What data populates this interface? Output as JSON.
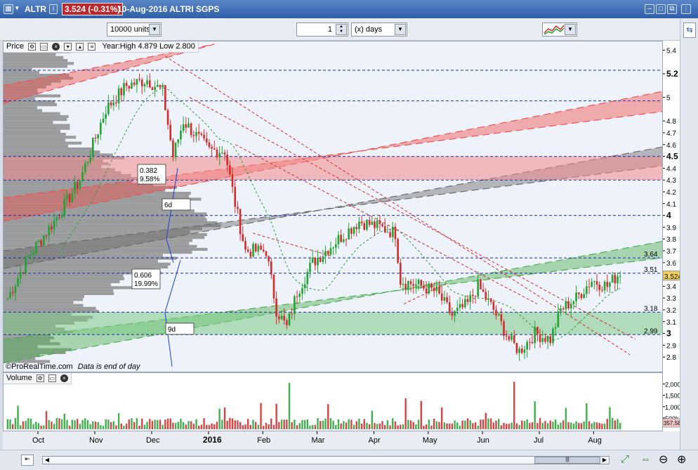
{
  "window": {
    "ticker": "ALTR",
    "price_change": "3.524 (-0.31%)",
    "date_name": "10-Aug-2016 ALTRI SGPS"
  },
  "toolbar": {
    "units_value": "10000 units",
    "period_value": "1",
    "period_unit": "(x) days"
  },
  "price_panel": {
    "label": "Price",
    "yearinfo": "Year:High 4.879 Low 2.800",
    "credit": "©ProRealTime.com",
    "note": "Data is end of day",
    "fib1_ratio": "0.382",
    "fib1_pct": "9.58%",
    "fib2_ratio": "0.606",
    "fib2_pct": "19.99%",
    "cycle1": "6d",
    "cycle2": "9d"
  },
  "volume_panel": {
    "label": "Volume",
    "axis_labels": [
      "2,000k",
      "1,500k",
      "1,000k",
      "500k"
    ],
    "last_value": "357,587"
  },
  "colors": {
    "up": "#22a233",
    "down": "#d62a2a",
    "accent": "#2f5ea8",
    "volume_up": "#3fb24f",
    "volume_down": "#d64545"
  },
  "chart_data": {
    "type": "candlestick",
    "ylim": [
      2.7,
      5.45
    ],
    "y_ticks": [
      {
        "v": 5.4,
        "label": "5.4"
      },
      {
        "v": 5.2,
        "label": "5.2",
        "bold": true
      },
      {
        "v": 5.0,
        "label": "5"
      },
      {
        "v": 4.8,
        "label": "4.8"
      },
      {
        "v": 4.7,
        "label": "4.7"
      },
      {
        "v": 4.6,
        "label": "4.6"
      },
      {
        "v": 4.5,
        "label": "4.5",
        "bold": true
      },
      {
        "v": 4.4,
        "label": "4.4"
      },
      {
        "v": 4.3,
        "label": "4.3"
      },
      {
        "v": 4.2,
        "label": "4.2"
      },
      {
        "v": 4.1,
        "label": "4.1"
      },
      {
        "v": 4.0,
        "label": "4",
        "bold": true
      },
      {
        "v": 3.9,
        "label": "3.9"
      },
      {
        "v": 3.8,
        "label": "3.8"
      },
      {
        "v": 3.7,
        "label": "3.7"
      },
      {
        "v": 3.6,
        "label": "3.6"
      },
      {
        "v": 3.5,
        "label": "3.5"
      },
      {
        "v": 3.4,
        "label": "3.4"
      },
      {
        "v": 3.3,
        "label": "3.3"
      },
      {
        "v": 3.2,
        "label": "3.2"
      },
      {
        "v": 3.1,
        "label": "3.1"
      },
      {
        "v": 3.0,
        "label": "3",
        "bold": true
      },
      {
        "v": 2.9,
        "label": "2.9"
      },
      {
        "v": 2.8,
        "label": "2.8"
      }
    ],
    "level_labels": [
      {
        "v": 3.64,
        "label": "3.64"
      },
      {
        "v": 3.51,
        "label": "3.51"
      },
      {
        "v": 3.18,
        "label": "3.18"
      },
      {
        "v": 2.99,
        "label": "2.99"
      }
    ],
    "last_price_label": "3.524",
    "x_labels": [
      {
        "i": 12,
        "label": "Oct"
      },
      {
        "i": 34,
        "label": "Nov"
      },
      {
        "i": 56,
        "label": "Dec"
      },
      {
        "i": 78,
        "label": "2016",
        "bold": true
      },
      {
        "i": 99,
        "label": "Feb"
      },
      {
        "i": 120,
        "label": "Mar"
      },
      {
        "i": 142,
        "label": "Apr"
      },
      {
        "i": 163,
        "label": "May"
      },
      {
        "i": 184,
        "label": "Jun"
      },
      {
        "i": 206,
        "label": "Jul"
      },
      {
        "i": 227,
        "label": "Aug"
      }
    ],
    "n_bars": 238,
    "keyframes": [
      [
        0,
        3.3
      ],
      [
        8,
        3.65
      ],
      [
        18,
        3.95
      ],
      [
        28,
        4.3
      ],
      [
        38,
        4.9
      ],
      [
        46,
        5.1
      ],
      [
        54,
        5.15
      ],
      [
        60,
        5.05
      ],
      [
        64,
        4.5
      ],
      [
        68,
        4.8
      ],
      [
        78,
        4.55
      ],
      [
        84,
        4.55
      ],
      [
        88,
        4.1
      ],
      [
        92,
        3.7
      ],
      [
        100,
        3.7
      ],
      [
        104,
        3.2
      ],
      [
        108,
        3.05
      ],
      [
        112,
        3.35
      ],
      [
        118,
        3.6
      ],
      [
        128,
        3.8
      ],
      [
        136,
        3.95
      ],
      [
        144,
        3.9
      ],
      [
        150,
        3.85
      ],
      [
        152,
        3.45
      ],
      [
        160,
        3.4
      ],
      [
        166,
        3.35
      ],
      [
        172,
        3.15
      ],
      [
        178,
        3.25
      ],
      [
        182,
        3.4
      ],
      [
        188,
        3.2
      ],
      [
        194,
        2.95
      ],
      [
        198,
        2.85
      ],
      [
        204,
        3.0
      ],
      [
        210,
        2.95
      ],
      [
        214,
        3.2
      ],
      [
        220,
        3.3
      ],
      [
        226,
        3.45
      ],
      [
        232,
        3.4
      ],
      [
        237,
        3.52
      ]
    ]
  }
}
